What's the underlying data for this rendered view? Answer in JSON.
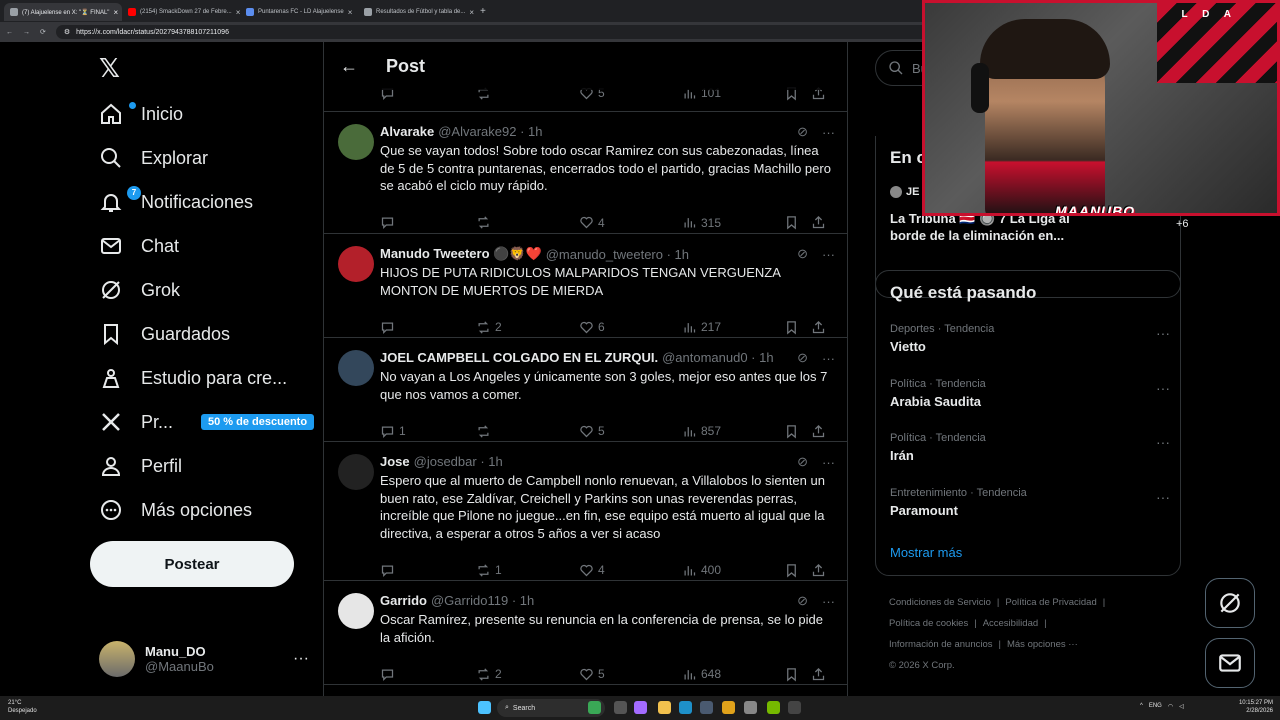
{
  "browser": {
    "tabs": [
      {
        "title": "(7) Alajuelense en X: \"⏳ FINAL\"",
        "color": "#9aa0a6",
        "active": true
      },
      {
        "title": "(2154) SmackDown 27 de Febre...",
        "color": "#ff0000",
        "active": false
      },
      {
        "title": "Puntarenas FC - LD Alajuelense",
        "color": "#5b8def",
        "active": false
      },
      {
        "title": "Resultados de Fútbol y tabla de...",
        "color": "#9aa0a6",
        "active": false
      }
    ],
    "new_tab": "+",
    "url": "https://x.com/ldacr/status/2027943788107211096"
  },
  "nav": {
    "logo": "𝕏",
    "items": [
      {
        "label": "Inicio",
        "icon": "home-icon"
      },
      {
        "label": "Explorar",
        "icon": "search-icon"
      },
      {
        "label": "Notificaciones",
        "icon": "bell-icon",
        "badge": "7"
      },
      {
        "label": "Chat",
        "icon": "mail-icon"
      },
      {
        "label": "Grok",
        "icon": "grok-icon"
      },
      {
        "label": "Guardados",
        "icon": "bookmark-icon"
      },
      {
        "label": "Estudio para cre...",
        "icon": "studio-icon"
      },
      {
        "label": "Pr...",
        "icon": "x-premium-icon",
        "promo": "50 % de descuento"
      },
      {
        "label": "Perfil",
        "icon": "person-icon"
      },
      {
        "label": "Más opciones",
        "icon": "more-circle-icon"
      }
    ],
    "post_button": "Postear",
    "profile": {
      "name": "Manu_DO",
      "handle": "@MaanuBo",
      "more": "···"
    }
  },
  "main": {
    "back": "←",
    "title": "Post",
    "top_actions": {
      "likes": "5",
      "views": "101"
    },
    "tweets": [
      {
        "name": "Alvarake",
        "handle": "@Alvarake92 · 1h",
        "text": "Que se vayan todos! Sobre todo oscar Ramirez con sus cabezonadas, línea de 5 de 5 contra puntarenas, encerrados todo el partido, gracias Machillo pero se acabó el ciclo muy rápido.",
        "replies": "",
        "retweets": "",
        "likes": "4",
        "views": "315",
        "avatar_color": "#4a6b3a"
      },
      {
        "name": "Manudo Tweetero ⚫🦁❤️",
        "handle": "@manudo_tweetero · 1h",
        "text": "HIJOS DE PUTA RIDICULOS MALPARIDOS TENGAN VERGUENZA MONTON DE MUERTOS DE MIERDA",
        "replies": "",
        "retweets": "2",
        "likes": "6",
        "views": "217",
        "avatar_color": "#b3202a"
      },
      {
        "name": "JOEL CAMPBELL COLGADO EN EL ZURQUI.",
        "handle": "@antomanud0 · 1h",
        "text": "No vayan a Los Angeles y únicamente son 3 goles, mejor eso antes que los 7 que nos vamos a comer.",
        "replies": "1",
        "retweets": "",
        "likes": "5",
        "views": "857",
        "avatar_color": "#33475b"
      },
      {
        "name": "Jose",
        "handle": "@josedbar · 1h",
        "text": "Espero que al muerto de Campbell nonlo renuevan, a Villalobos lo sienten un buen rato, ese Zaldívar, Creichell y Parkins son unas reverendas perras, increíble que Pilone no juegue...en fin, ese equipo está muerto al igual que la directiva, a esperar a otros 5 años a ver si acaso",
        "replies": "",
        "retweets": "1",
        "likes": "4",
        "views": "400",
        "avatar_color": "#222222"
      },
      {
        "name": "Garrido",
        "handle": "@Garrido119 · 1h",
        "text": "Oscar Ramírez, presente su renuncia en la conferencia de prensa, se lo pide la afición.",
        "replies": "",
        "retweets": "2",
        "likes": "5",
        "views": "648",
        "avatar_color": "#e6e6e6"
      }
    ]
  },
  "right": {
    "search_placeholder": "Bu",
    "news": {
      "title": "En c",
      "source": "JE",
      "headline": "La Tribuna 🇨🇷 🔘 7 La Liga al borde de la eliminación en...",
      "plus": "+6"
    },
    "trends_title": "Qué está pasando",
    "trends": [
      {
        "category": "Deportes · Tendencia",
        "name": "Vietto"
      },
      {
        "category": "Política · Tendencia",
        "name": "Arabia Saudita"
      },
      {
        "category": "Política · Tendencia",
        "name": "Irán"
      },
      {
        "category": "Entretenimiento · Tendencia",
        "name": "Paramount"
      }
    ],
    "show_more": "Mostrar más",
    "footer": {
      "links1": [
        "Condiciones de Servicio",
        "|",
        "Política de Privacidad",
        "|"
      ],
      "links2": [
        "Política de cookies",
        "|",
        "Accesibilidad",
        "|"
      ],
      "links3": [
        "Información de anuncios",
        "|",
        "Más opciones ···"
      ],
      "copyright": "© 2026 X Corp."
    }
  },
  "webcam": {
    "flag_text": "L D A",
    "overlay_name": "MAANUBO"
  },
  "taskbar": {
    "weather_temp": "21°C",
    "weather_desc": "Despejado",
    "search": "Search",
    "lang": "ENG",
    "time": "10:15:27 PM",
    "date": "2/28/2026"
  }
}
